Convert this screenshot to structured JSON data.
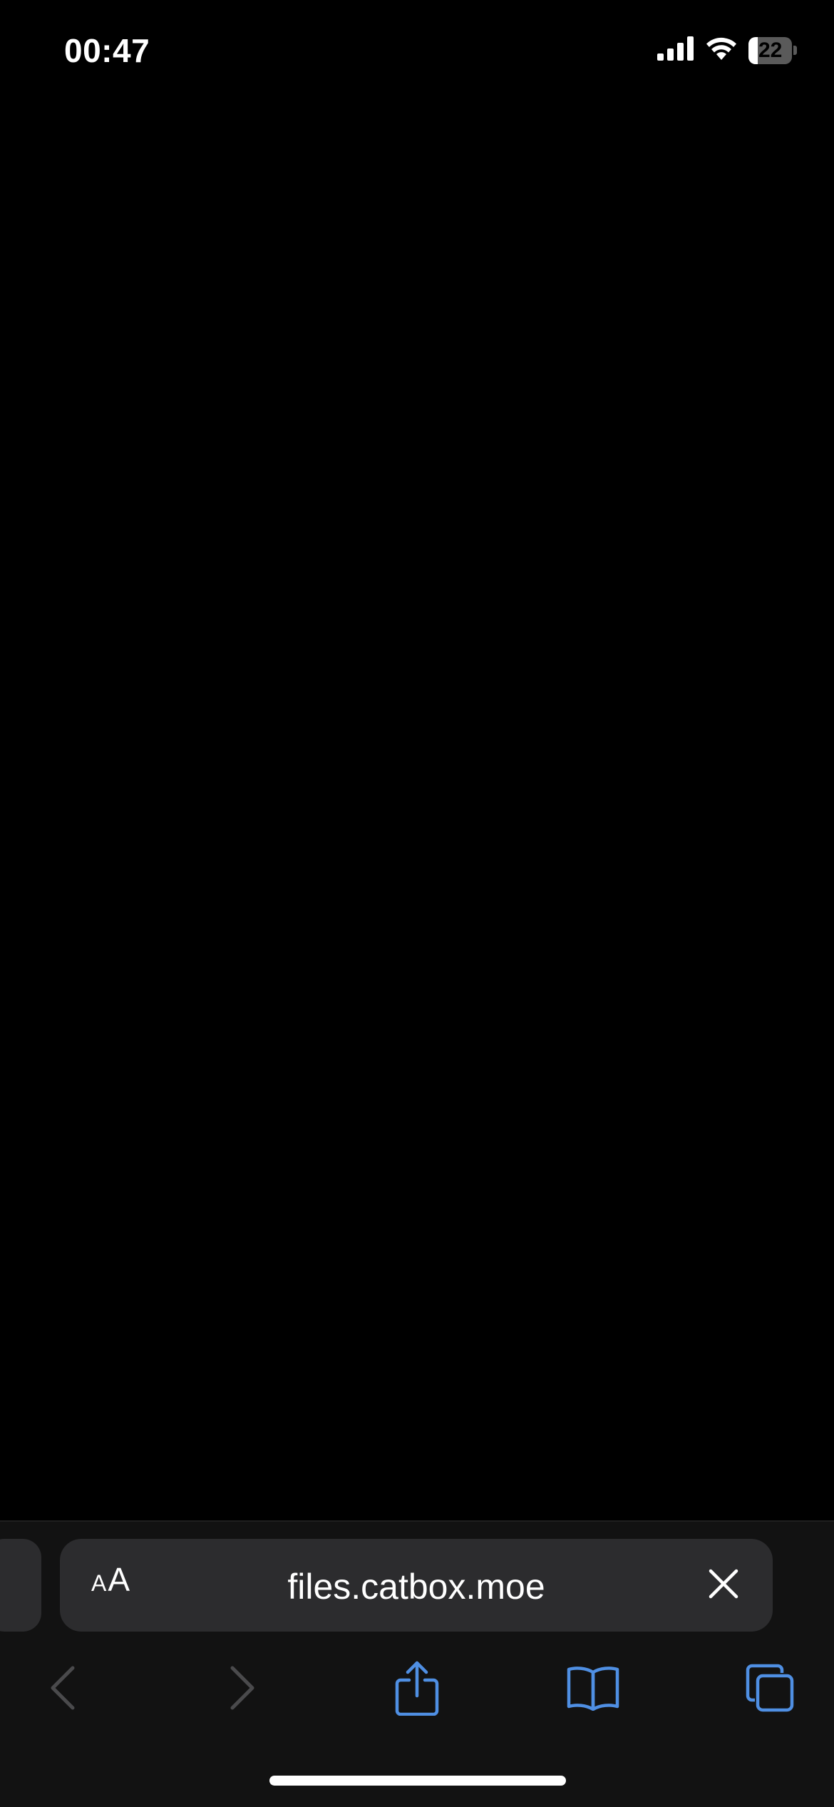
{
  "status_bar": {
    "time": "00:47",
    "battery_level": "22",
    "battery_fraction": 0.22,
    "icons": [
      "cellular-signal-icon",
      "wifi-icon",
      "battery-icon"
    ]
  },
  "address_bar": {
    "text_size_small": "A",
    "text_size_large": "A",
    "url": "files.catbox.moe",
    "clear_icon": "close-icon"
  },
  "toolbar": {
    "icons": [
      "back-chevron-icon",
      "forward-chevron-icon",
      "share-icon",
      "bookmarks-book-icon",
      "tabs-icon"
    ]
  },
  "colors": {
    "accent": "#4f8fe3",
    "disabled": "#4a4a4c",
    "bar_background": "#121212",
    "field_background": "#2c2c2e"
  }
}
